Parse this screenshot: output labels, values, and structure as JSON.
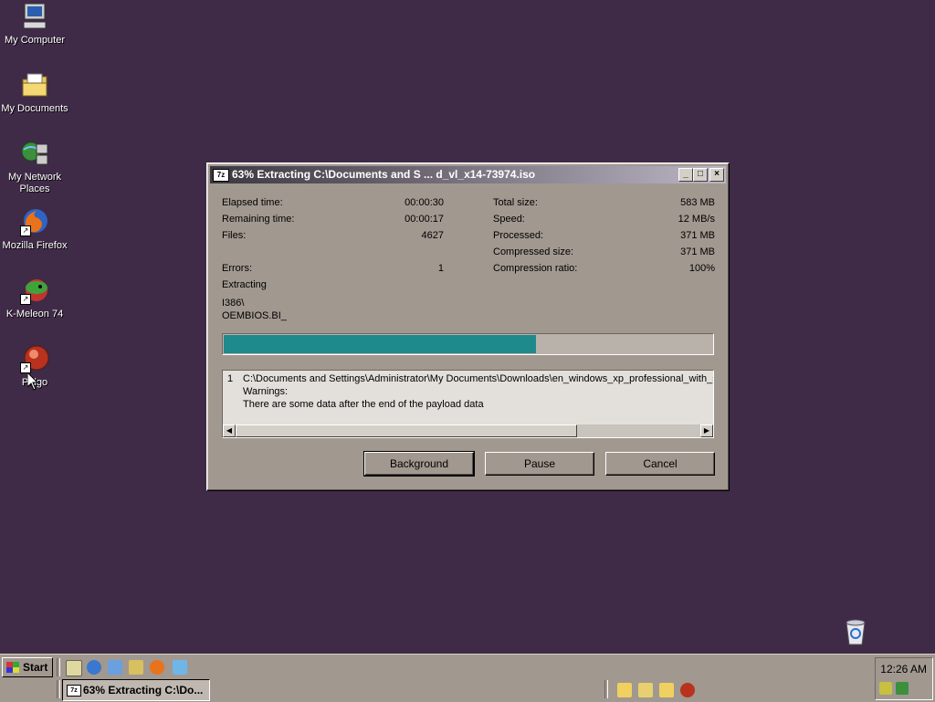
{
  "desktop": {
    "icons": [
      {
        "label": "My Computer"
      },
      {
        "label": "My Documents"
      },
      {
        "label": "My Network Places"
      },
      {
        "label": "Mozilla Firefox"
      },
      {
        "label": "K-Meleon 74"
      },
      {
        "label": "Pidgo"
      }
    ]
  },
  "dialog": {
    "title": "63% Extracting C:\\Documents and S ... d_vl_x14-73974.iso",
    "app_icon": "7z",
    "left_stats": [
      {
        "label": "Elapsed time:",
        "value": "00:00:30"
      },
      {
        "label": "Remaining time:",
        "value": "00:00:17"
      },
      {
        "label": "Files:",
        "value": "4627"
      },
      {
        "label": "Errors:",
        "value": "1"
      }
    ],
    "right_stats": [
      {
        "label": "Total size:",
        "value": "583 MB"
      },
      {
        "label": "Speed:",
        "value": "12 MB/s"
      },
      {
        "label": "Processed:",
        "value": "371 MB"
      },
      {
        "label": "Compressed size:",
        "value": "371 MB"
      },
      {
        "label": "Compression ratio:",
        "value": "100%"
      }
    ],
    "status_label": "Extracting",
    "current_path": "I386\\",
    "current_file": "OEMBIOS.BI_",
    "progress_fraction": 0.637,
    "log": {
      "number": "1",
      "lines": [
        "C:\\Documents and Settings\\Administrator\\My Documents\\Downloads\\en_windows_xp_professional_with_se",
        "Warnings:",
        "There are some data after the end of the payload data"
      ]
    },
    "buttons": {
      "background": "Background",
      "pause": "Pause",
      "cancel": "Cancel"
    }
  },
  "taskbar": {
    "start_label": "Start",
    "task_label": "63% Extracting C:\\Do...",
    "task_icon": "7z",
    "clock": "12:26 AM"
  },
  "colors": {
    "desktop": "#3f2a47",
    "progress_fill": "#1e8a8c",
    "window_face": "#a19890"
  }
}
